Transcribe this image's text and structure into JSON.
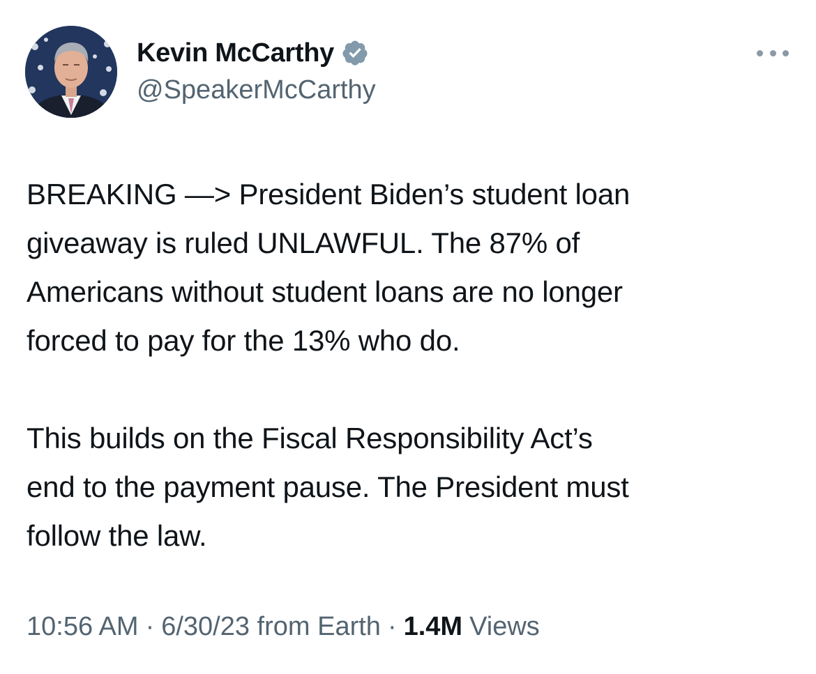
{
  "author": {
    "display_name": "Kevin McCarthy",
    "handle": "@SpeakerMcCarthy",
    "verified_icon": "verified-badge-icon",
    "verified_color": "#829aab"
  },
  "menu": {
    "icon": "more-options-icon"
  },
  "tweet": {
    "paragraph1_lines": [
      "BREAKING —> President Biden’s student loan",
      "giveaway is ruled UNLAWFUL. The 87% of",
      "Americans without student loans are no longer",
      "forced to pay for the 13% who do."
    ],
    "paragraph2_lines": [
      "This builds on the Fiscal Responsibility Act’s",
      "end to the payment pause. The President must",
      "follow the law."
    ]
  },
  "meta": {
    "time": "10:56 AM",
    "separator": "·",
    "date_source": "6/30/23 from Earth",
    "views_count": "1.4M",
    "views_label": "Views"
  },
  "colors": {
    "text": "#0f1419",
    "secondary": "#536471"
  }
}
